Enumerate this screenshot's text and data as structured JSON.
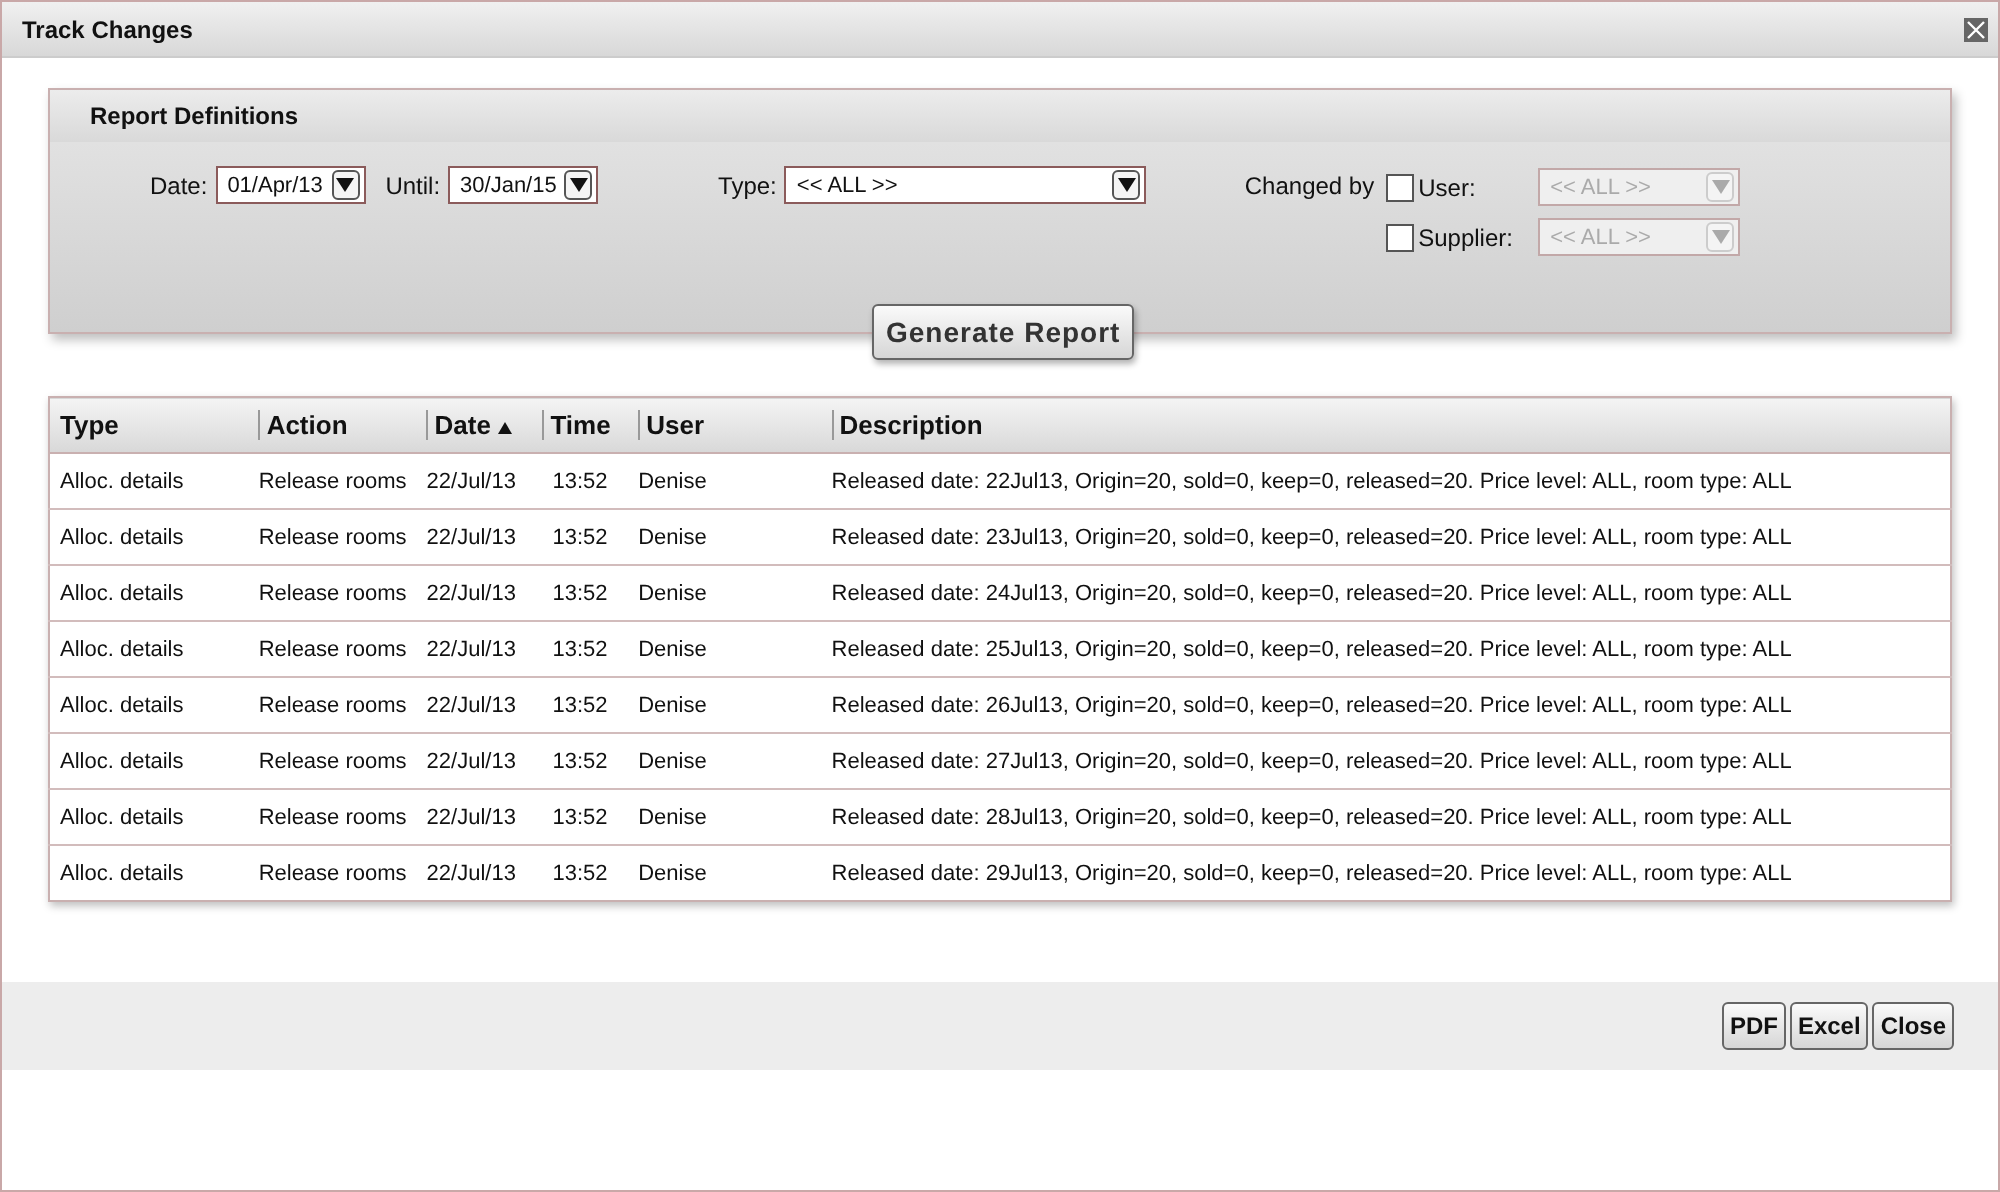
{
  "window": {
    "title": "Track Changes"
  },
  "report_definitions": {
    "title": "Report Definitions",
    "date": {
      "label": "Date:",
      "value": "01/Apr/13"
    },
    "until": {
      "label": "Until:",
      "value": "30/Jan/15"
    },
    "type": {
      "label": "Type:",
      "value": "<< ALL >>"
    },
    "changed_by": {
      "label": "Changed by",
      "filters": [
        {
          "label": "User:",
          "checked": false,
          "value": "<< ALL >>",
          "disabled": true
        },
        {
          "label": "Supplier:",
          "checked": false,
          "value": "<< ALL >>",
          "disabled": true
        }
      ]
    },
    "generate_button": "Generate Report"
  },
  "table": {
    "columns": [
      {
        "label": "Type",
        "sorted": false
      },
      {
        "label": "Action",
        "sorted": false
      },
      {
        "label": "Date",
        "sorted": true
      },
      {
        "label": "Time",
        "sorted": false
      },
      {
        "label": "User",
        "sorted": false
      },
      {
        "label": "Description",
        "sorted": false
      }
    ],
    "rows": [
      [
        "Alloc. details",
        "Release rooms",
        "22/Jul/13",
        "13:52",
        "Denise",
        "Released date: 22Jul13, Origin=20, sold=0, keep=0, released=20. Price level: ALL, room type: ALL"
      ],
      [
        "Alloc. details",
        "Release rooms",
        "22/Jul/13",
        "13:52",
        "Denise",
        "Released date: 23Jul13, Origin=20, sold=0, keep=0, released=20. Price level: ALL, room type: ALL"
      ],
      [
        "Alloc. details",
        "Release rooms",
        "22/Jul/13",
        "13:52",
        "Denise",
        "Released date: 24Jul13, Origin=20, sold=0, keep=0, released=20. Price level: ALL, room type: ALL"
      ],
      [
        "Alloc. details",
        "Release rooms",
        "22/Jul/13",
        "13:52",
        "Denise",
        "Released date: 25Jul13, Origin=20, sold=0, keep=0, released=20. Price level: ALL, room type: ALL"
      ],
      [
        "Alloc. details",
        "Release rooms",
        "22/Jul/13",
        "13:52",
        "Denise",
        "Released date: 26Jul13, Origin=20, sold=0, keep=0, released=20. Price level: ALL, room type: ALL"
      ],
      [
        "Alloc. details",
        "Release rooms",
        "22/Jul/13",
        "13:52",
        "Denise",
        "Released date: 27Jul13, Origin=20, sold=0, keep=0, released=20. Price level: ALL, room type: ALL"
      ],
      [
        "Alloc. details",
        "Release rooms",
        "22/Jul/13",
        "13:52",
        "Denise",
        "Released date: 28Jul13, Origin=20, sold=0, keep=0, released=20. Price level: ALL, room type: ALL"
      ],
      [
        "Alloc. details",
        "Release rooms",
        "22/Jul/13",
        "13:52",
        "Denise",
        "Released date: 29Jul13, Origin=20, sold=0, keep=0, released=20. Price level: ALL, room type: ALL"
      ]
    ]
  },
  "buttons": [
    "PDF",
    "Excel",
    "Close"
  ]
}
